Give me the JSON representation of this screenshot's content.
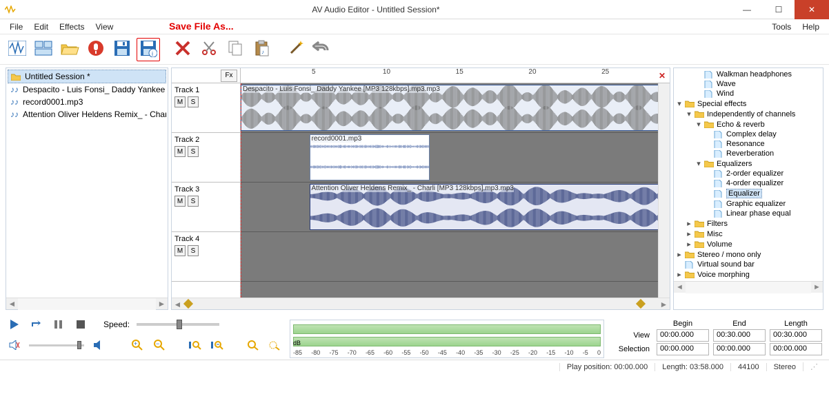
{
  "window": {
    "title": "AV Audio Editor - Untitled Session*"
  },
  "annotation": "Save File As...",
  "menu": {
    "left": [
      "File",
      "Edit",
      "Effects",
      "View"
    ],
    "right": [
      "Tools",
      "Help"
    ]
  },
  "toolbar": [
    {
      "name": "new-session",
      "icon": "wave-blue"
    },
    {
      "name": "tile-windows",
      "icon": "tiles"
    },
    {
      "name": "open",
      "icon": "folder-open"
    },
    {
      "name": "record",
      "icon": "record"
    },
    {
      "name": "save",
      "icon": "floppy"
    },
    {
      "name": "save-as",
      "icon": "floppy-info",
      "outline": true
    },
    {
      "sep": true
    },
    {
      "name": "delete",
      "icon": "x-red"
    },
    {
      "name": "cut",
      "icon": "scissors"
    },
    {
      "name": "copy",
      "icon": "copy"
    },
    {
      "name": "paste",
      "icon": "paste"
    },
    {
      "sep": true
    },
    {
      "name": "effects-wand",
      "icon": "wand"
    },
    {
      "name": "undo",
      "icon": "undo"
    }
  ],
  "session": {
    "header": "Untitled Session *",
    "items": [
      "Despacito - Luis Fonsi_ Daddy Yankee",
      "record0001.mp3",
      "Attention Oliver Heldens Remix_ - Charli"
    ]
  },
  "ruler": {
    "fx": "Fx",
    "ticks": [
      "5",
      "10",
      "15",
      "20",
      "25"
    ]
  },
  "tracks": {
    "heads": [
      "Track 1",
      "Track 2",
      "Track 3",
      "Track 4"
    ],
    "m": "M",
    "s": "S",
    "clips": {
      "t1": "Despacito - Luis Fonsi_ Daddy Yankee [MP3 128kbps].mp3.mp3",
      "t2": "record0001.mp3",
      "t3": "Attention Oliver Heldens Remix_ - Charli [MP3 128kbps].mp3.mp3"
    }
  },
  "tree": [
    {
      "d": 2,
      "t": "file",
      "l": "Walkman headphones"
    },
    {
      "d": 2,
      "t": "file",
      "l": "Wave"
    },
    {
      "d": 2,
      "t": "file",
      "l": "Wind"
    },
    {
      "d": 0,
      "t": "folder",
      "tw": "▾",
      "l": "Special effects"
    },
    {
      "d": 1,
      "t": "folder",
      "tw": "▾",
      "l": "Independently of channels"
    },
    {
      "d": 2,
      "t": "folder",
      "tw": "▾",
      "l": "Echo & reverb"
    },
    {
      "d": 3,
      "t": "file",
      "l": "Complex delay"
    },
    {
      "d": 3,
      "t": "file",
      "l": "Resonance"
    },
    {
      "d": 3,
      "t": "file",
      "l": "Reverberation"
    },
    {
      "d": 2,
      "t": "folder",
      "tw": "▾",
      "l": "Equalizers"
    },
    {
      "d": 3,
      "t": "file",
      "l": "2-order equalizer"
    },
    {
      "d": 3,
      "t": "file",
      "l": "4-order equalizer"
    },
    {
      "d": 3,
      "t": "file",
      "l": "Equalizer",
      "sel": true
    },
    {
      "d": 3,
      "t": "file",
      "l": "Graphic equalizer"
    },
    {
      "d": 3,
      "t": "file",
      "l": "Linear phase equal"
    },
    {
      "d": 1,
      "t": "folder",
      "tw": "▸",
      "l": "Filters"
    },
    {
      "d": 1,
      "t": "folder",
      "tw": "▸",
      "l": "Misc"
    },
    {
      "d": 1,
      "t": "folder",
      "tw": "▸",
      "l": "Volume"
    },
    {
      "d": 0,
      "t": "folder",
      "tw": "▸",
      "l": "Stereo / mono only"
    },
    {
      "d": 0,
      "t": "file",
      "l": "Virtual sound bar"
    },
    {
      "d": 0,
      "t": "folder",
      "tw": "▸",
      "l": "Voice morphing"
    }
  ],
  "transport": {
    "speed_label": "Speed:"
  },
  "db": {
    "label": "dB",
    "ticks": [
      "-85",
      "-80",
      "-75",
      "-70",
      "-65",
      "-60",
      "-55",
      "-50",
      "-45",
      "-40",
      "-35",
      "-30",
      "-25",
      "-20",
      "-15",
      "-10",
      "-5",
      "0"
    ]
  },
  "timegrid": {
    "cols": [
      "Begin",
      "End",
      "Length"
    ],
    "rows": {
      "View": [
        "00:00.000",
        "00:30.000",
        "00:30.000"
      ],
      "Selection": [
        "00:00.000",
        "00:00.000",
        "00:00.000"
      ]
    }
  },
  "status": {
    "play_pos": "Play position: 00:00.000",
    "length": "Length: 03:58.000",
    "rate": "44100",
    "channels": "Stereo"
  }
}
